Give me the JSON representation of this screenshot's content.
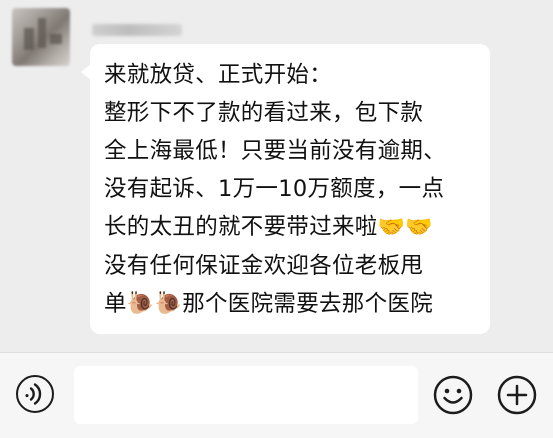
{
  "message": {
    "lines": [
      "来就放贷、正式开始：",
      "整形下不了款的看过来，包下款",
      "全上海最低！只要当前没有逾期、",
      "没有起诉、1万一10万额度，一点",
      "长的太丑的就不要带过来啦",
      "没有任何保证金欢迎各位老板甩",
      "单",
      "那个医院需要去那个医院"
    ],
    "line5_emojis": "🤝🤝",
    "line7_emojis": "🐌🐌"
  },
  "input_bar": {
    "voice_icon": "voice-icon",
    "emoji_icon": "smiley-icon",
    "plus_icon": "plus-icon"
  }
}
